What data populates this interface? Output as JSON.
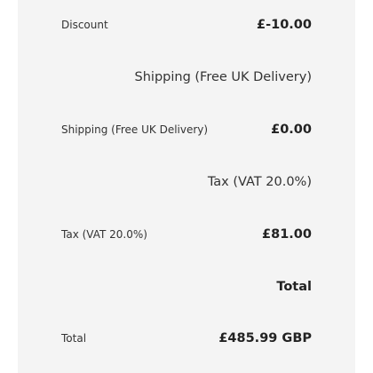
{
  "summary": {
    "discount_label": "Discount",
    "discount_value": "£-10.00",
    "shipping_heading": "Shipping (Free UK Delivery)",
    "shipping_label": "Shipping (Free UK Delivery)",
    "shipping_value": "£0.00",
    "tax_heading": "Tax (VAT 20.0%)",
    "tax_label": "Tax (VAT 20.0%)",
    "tax_value": "£81.00",
    "total_heading": "Total",
    "total_label": "Total",
    "total_value": "£485.99 GBP"
  }
}
